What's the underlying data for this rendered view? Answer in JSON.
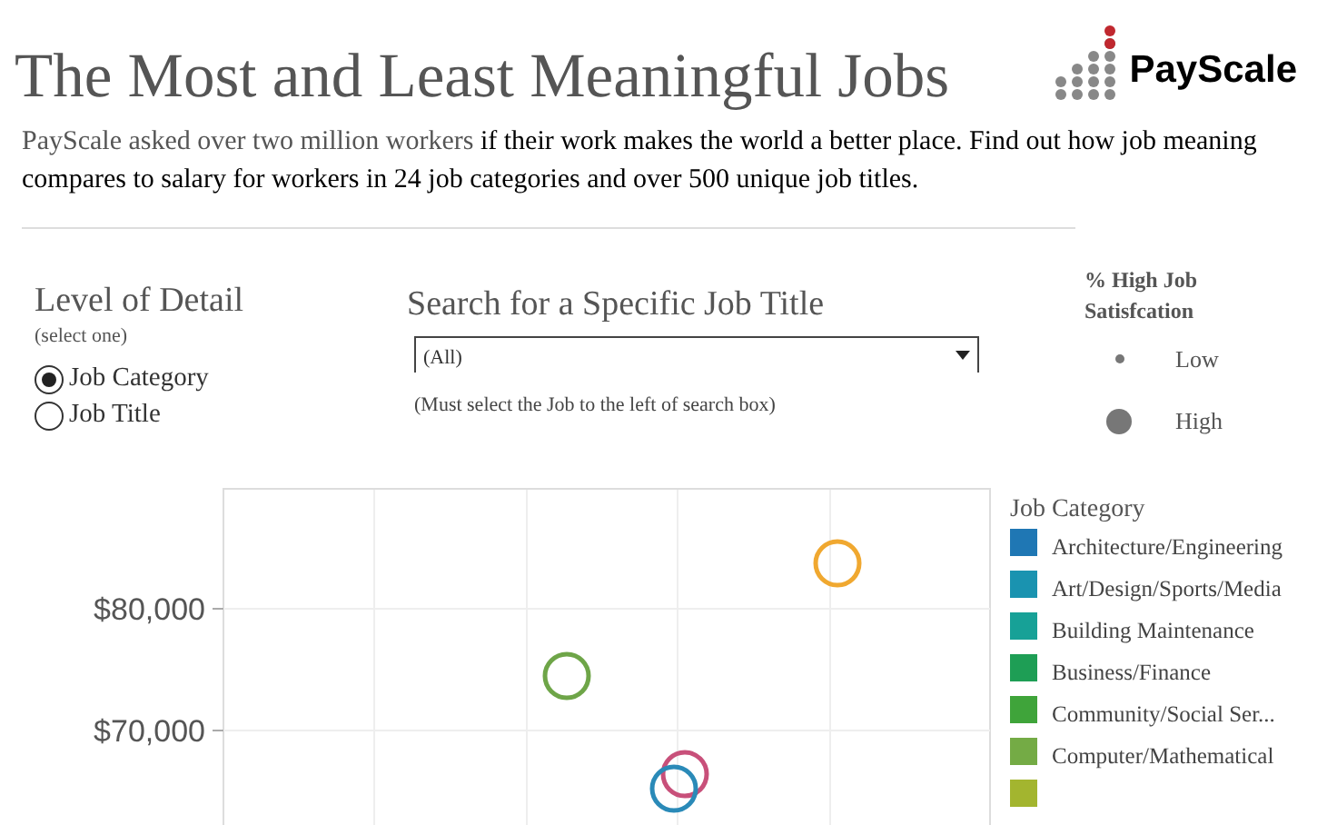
{
  "header": {
    "title": "The Most and Least Meaningful Jobs",
    "logo_text": "PayScale"
  },
  "intro": {
    "lead": "PayScale asked over two million workers",
    "text": " if their work makes the world a better place. Find out how job meaning compares to salary for workers in 24 job categories and over 500 unique job titles."
  },
  "level_of_detail": {
    "title": "Level of Detail",
    "hint": "(select one)",
    "options": [
      {
        "label": "Job Category",
        "selected": true
      },
      {
        "label": "Job Title",
        "selected": false
      }
    ]
  },
  "search": {
    "title": "Search for a Specific Job Title",
    "value": "(All)",
    "note": "(Must select the Job to the left of search box)"
  },
  "size_legend": {
    "title": "% High Job Satisfcation",
    "items": [
      {
        "label": "Low",
        "kind": "small"
      },
      {
        "label": "High",
        "kind": "large"
      }
    ]
  },
  "chart": {
    "y_axis_labels": [
      "$80,000",
      "$70,000"
    ]
  },
  "category_legend": {
    "title": "Job Category",
    "items": [
      {
        "label": "Architecture/Engineering",
        "color": "#1f77b4"
      },
      {
        "label": "Art/Design/Sports/Media",
        "color": "#1a93b0"
      },
      {
        "label": "Building Maintenance",
        "color": "#17a197"
      },
      {
        "label": "Business/Finance",
        "color": "#1e9e55"
      },
      {
        "label": "Community/Social Ser...",
        "color": "#3fa43a"
      },
      {
        "label": "Computer/Mathematical",
        "color": "#74ab45"
      },
      {
        "color": "#a3b52f"
      }
    ]
  }
}
